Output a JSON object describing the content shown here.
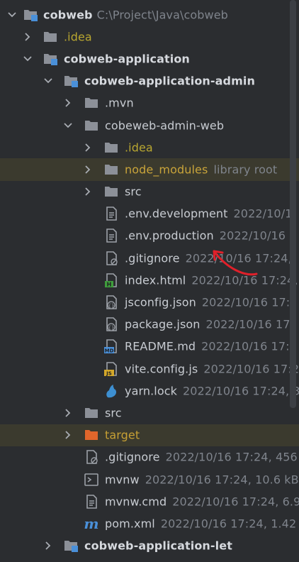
{
  "tree": {
    "root": {
      "name": "cobweb",
      "path": "C:\\Project\\Java\\cobweb"
    },
    "idea_root": {
      "name": ".idea"
    },
    "app": {
      "name": "cobweb-application"
    },
    "admin": {
      "name": "cobweb-application-admin"
    },
    "mvn": {
      "name": ".mvn"
    },
    "admin_web": {
      "name": "cobeweb-admin-web"
    },
    "idea_web": {
      "name": ".idea"
    },
    "node_modules": {
      "name": "node_modules",
      "meta": "library root"
    },
    "src_web": {
      "name": "src"
    },
    "env_dev": {
      "name": ".env.development",
      "meta": "2022/10/1"
    },
    "env_prod": {
      "name": ".env.production",
      "meta": "2022/10/16 1"
    },
    "gitignore_web": {
      "name": ".gitignore",
      "meta": "2022/10/16 17:24,"
    },
    "index_html": {
      "name": "index.html",
      "meta": "2022/10/16 17:24,"
    },
    "jsconfig": {
      "name": "jsconfig.json",
      "meta": "2022/10/16 17:2"
    },
    "package_json": {
      "name": "package.json",
      "meta": "2022/10/16 17:"
    },
    "readme": {
      "name": "README.md",
      "meta": "2022/10/16 17:2"
    },
    "vite": {
      "name": "vite.config.js",
      "meta": "2022/10/16 17:2"
    },
    "yarn": {
      "name": "yarn.lock",
      "meta": "2022/10/16 17:24, 3"
    },
    "src_admin": {
      "name": "src"
    },
    "target": {
      "name": "target"
    },
    "gitignore_admin": {
      "name": ".gitignore",
      "meta": "2022/10/16 17:24, 456"
    },
    "mvnw": {
      "name": "mvnw",
      "meta": "2022/10/16 17:24, 10.6 kB"
    },
    "mvnw_cmd": {
      "name": "mvnw.cmd",
      "meta": "2022/10/16 17:24, 6.9"
    },
    "pom": {
      "name": "pom.xml",
      "meta": "2022/10/16 17:24, 1.42"
    },
    "let": {
      "name": "cobweb-application-let"
    }
  },
  "colors": {
    "background": "#2b2d30",
    "folder": "#8c9098",
    "module_folder_accent": "#4a90d9",
    "excluded_folder": "#e0662b",
    "annotation_arrow": "#e0202a"
  }
}
